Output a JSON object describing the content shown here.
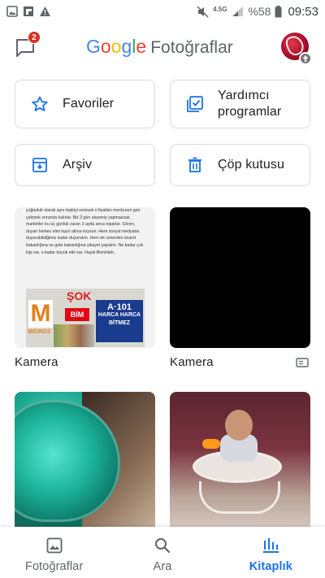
{
  "status_bar": {
    "signal_label": "4.5G",
    "battery": "%58",
    "time": "09:53",
    "left_icons": [
      "image-notification-icon",
      "flipboard-icon",
      "warning-icon"
    ],
    "right_icons": [
      "mute-icon",
      "signal-icon",
      "battery-icon"
    ]
  },
  "header": {
    "logo_google": [
      "G",
      "o",
      "o",
      "g",
      "l",
      "e"
    ],
    "logo_colors": [
      "#4285f4",
      "#ea4335",
      "#fbbc05",
      "#4285f4",
      "#34a853",
      "#ea4335"
    ],
    "app_name": "Fotoğraflar",
    "chat_badge": "2"
  },
  "actions": {
    "favorites": "Favoriler",
    "utilities_line1": "Yardımcı",
    "utilities_line2": "programlar",
    "archive": "Arşiv",
    "trash": "Çöp kutusu"
  },
  "albums": [
    {
      "title": "Kamera",
      "thumb_text": "çoğunluk olarak aynı tepkiyi verirsek o fiyatları mecburen geri çekmek zorunda kalırlar. Biz 3 gün alışveriş yapmazsak, marketler bu üç günlük zararı 3 ayda anca toparlar. Gören, duyan herkes elini taşın altına koysun. Hem sosyal medyada duyurabildiğimiz kadar duyuralım. Hem de cimerden ticaret bakanlığına ve gıda bakanlığına şikayet yapalım. Ne kadar çok kişi var, o kadar büyük etki var. Haydi Bismillah..",
      "ad_sok": "ŞOK",
      "ad_m": "M",
      "ad_migros": "MIGROS",
      "ad_bim": "BİM",
      "ad_a101": "A·101",
      "ad_slogan": "HARCA HARCA BİTMEZ"
    },
    {
      "title": "Kamera"
    },
    {
      "title": ""
    },
    {
      "title": ""
    }
  ],
  "bottom_nav": {
    "photos": "Fotoğraflar",
    "search": "Ara",
    "library": "Kitaplık",
    "active": "library",
    "accent": "#1a73e8"
  }
}
